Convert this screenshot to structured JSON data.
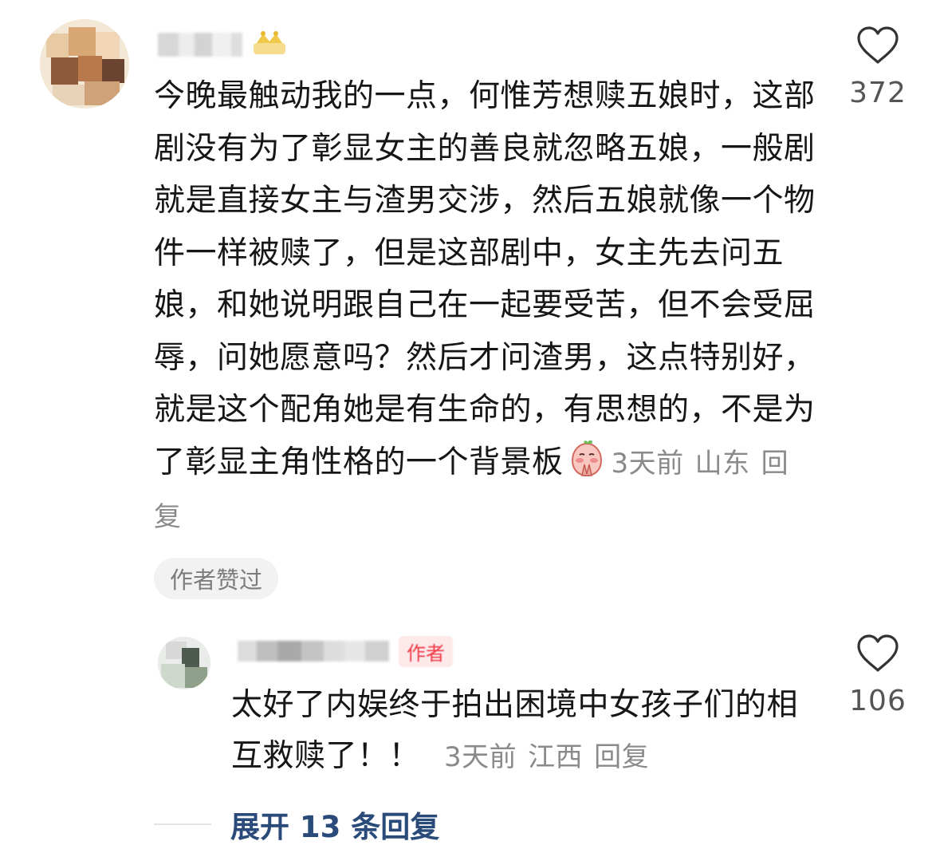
{
  "comment": {
    "username": "",
    "body": "今晚最触动我的一点，何惟芳想赎五娘时，这部剧没有为了彰显女主的善良就忽略五娘，一般剧就是直接女主与渣男交涉，然后五娘就像一个物件一样被赎了，但是这部剧中，女主先去问五娘，和她说明跟自己在一起要受苦，但不会受屈辱，问她愿意吗？然后才问渣男，这点特别好，就是这个配角她是有生命的，有思想的，不是为了彰显主角性格的一个背景板",
    "emoji_icon": "praying-peach-emoji",
    "time": "3天前",
    "location": "山东",
    "reply_label": "回复",
    "like_count": "372",
    "author_liked": "作者赞过"
  },
  "reply": {
    "username": "",
    "badge": "作者",
    "body": "太好了内娱终于拍出困境中女孩子们的相互救赎了！！",
    "time": "3天前",
    "location": "江西",
    "reply_label": "回复",
    "like_count": "106"
  },
  "expand": {
    "label": "展开 13 条回复"
  },
  "colors": {
    "text": "#161616",
    "meta": "#8a8a8a",
    "link": "#2a4b79",
    "badge_text": "#f03b48",
    "badge_bg": "#fde9ea"
  }
}
